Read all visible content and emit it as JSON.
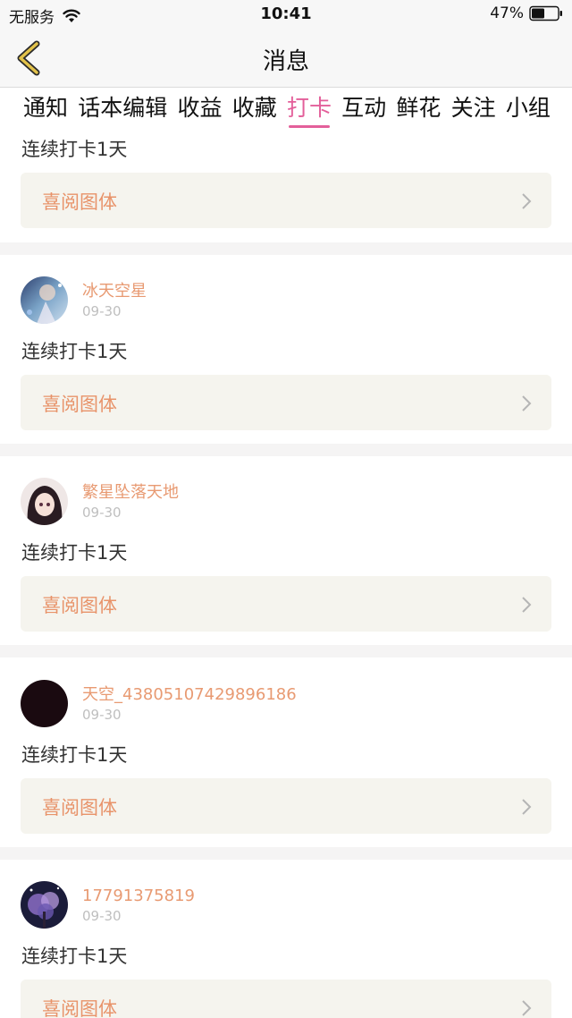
{
  "status_bar": {
    "carrier": "无服务",
    "time": "10:41",
    "battery": "47%"
  },
  "nav": {
    "title": "消息"
  },
  "tabs": [
    {
      "label": "通知"
    },
    {
      "label": "话本编辑"
    },
    {
      "label": "收益"
    },
    {
      "label": "收藏"
    },
    {
      "label": "打卡",
      "active": true
    },
    {
      "label": "互动"
    },
    {
      "label": "鲜花"
    },
    {
      "label": "关注"
    },
    {
      "label": "小组"
    }
  ],
  "messages": [
    {
      "text": "连续打卡1天",
      "book": "喜阅图体"
    },
    {
      "username": "冰天空星",
      "date": "09-30",
      "text": "连续打卡1天",
      "book": "喜阅图体"
    },
    {
      "username": "繁星坠落天地",
      "date": "09-30",
      "text": "连续打卡1天",
      "book": "喜阅图体"
    },
    {
      "username": "天空_43805107429896186",
      "date": "09-30",
      "text": "连续打卡1天",
      "book": "喜阅图体"
    },
    {
      "username": "17791375819",
      "date": "09-30",
      "text": "连续打卡1天",
      "book": "喜阅图体"
    }
  ],
  "colors": {
    "accent": "#e35f9a",
    "username": "#e89a72",
    "book_link_bg": "#f5f4ee",
    "back_icon": "#e2c24a"
  }
}
